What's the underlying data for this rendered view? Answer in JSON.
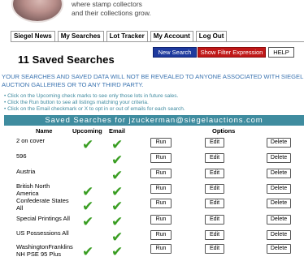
{
  "header": {
    "tagline_line1": "where stamp collectors",
    "tagline_line2": "and their collections grow."
  },
  "tabs": [
    {
      "label": "Siegel News",
      "active": false
    },
    {
      "label": "My Searches",
      "active": true
    },
    {
      "label": "Lot Tracker",
      "active": false
    },
    {
      "label": "My Account",
      "active": false
    },
    {
      "label": "Log Out",
      "active": false
    }
  ],
  "page": {
    "title": "11 Saved Searches",
    "new_search_label": "New Search",
    "show_filter_label": "Show Filter Expression",
    "help_label": "HELP"
  },
  "warning": {
    "line1": "YOUR SEARCHES AND SAVED DATA WILL NOT BE REVEALED TO ANYONE ASSOCIATED WITH SIEGEL",
    "line2": "AUCTION GALLERIES OR TO ANY THIRD PARTY."
  },
  "instructions": [
    "• Click on the Upcoming check marks to see only those lots in future sales.",
    "• Click the Run button to see all listings matching your criteria.",
    "• Click on the Email checkmark or X to opt in or out of emails for each search."
  ],
  "band": {
    "text": "Saved Searches for jzuckerman@siegelauctions.com"
  },
  "table": {
    "headers": {
      "name": "Name",
      "upcoming": "Upcoming",
      "email": "Email",
      "options": "Options"
    },
    "buttons": {
      "run": "Run",
      "edit": "Edit",
      "delete": "Delete"
    },
    "check_glyph": "✔",
    "rows": [
      {
        "name": "2 on cover",
        "upcoming": true,
        "email": true
      },
      {
        "name": "596",
        "upcoming": false,
        "email": true
      },
      {
        "name": "Austria",
        "upcoming": false,
        "email": true
      },
      {
        "name": "British North America",
        "upcoming": true,
        "email": true
      },
      {
        "name": "Confederate States All",
        "upcoming": true,
        "email": true
      },
      {
        "name": "Special Printings All",
        "upcoming": true,
        "email": true
      },
      {
        "name": "US Possessions All",
        "upcoming": false,
        "email": true
      },
      {
        "name": "WashingtonFranklins NH PSE 95 Plus",
        "upcoming": true,
        "email": true
      }
    ]
  },
  "colors": {
    "band": "#3f8c9f",
    "check": "#3a9e23",
    "warning": "#3a73b0",
    "new_search": "#1e3a9e",
    "filter": "#c01818"
  }
}
